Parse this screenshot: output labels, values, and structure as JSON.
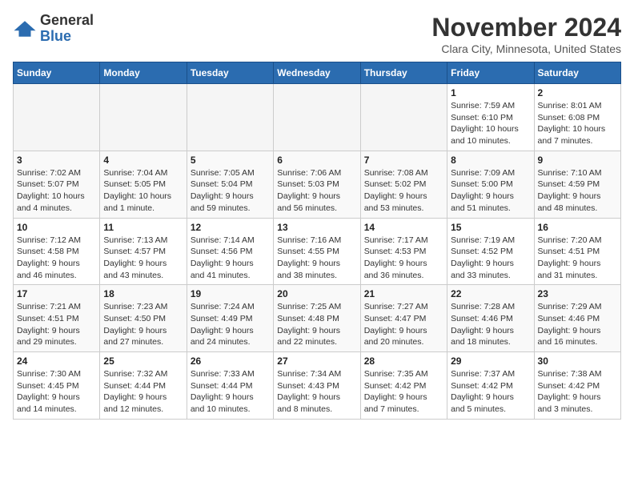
{
  "logo": {
    "general": "General",
    "blue": "Blue"
  },
  "header": {
    "month": "November 2024",
    "location": "Clara City, Minnesota, United States"
  },
  "weekdays": [
    "Sunday",
    "Monday",
    "Tuesday",
    "Wednesday",
    "Thursday",
    "Friday",
    "Saturday"
  ],
  "weeks": [
    [
      {
        "day": "",
        "info": ""
      },
      {
        "day": "",
        "info": ""
      },
      {
        "day": "",
        "info": ""
      },
      {
        "day": "",
        "info": ""
      },
      {
        "day": "",
        "info": ""
      },
      {
        "day": "1",
        "info": "Sunrise: 7:59 AM\nSunset: 6:10 PM\nDaylight: 10 hours\nand 10 minutes."
      },
      {
        "day": "2",
        "info": "Sunrise: 8:01 AM\nSunset: 6:08 PM\nDaylight: 10 hours\nand 7 minutes."
      }
    ],
    [
      {
        "day": "3",
        "info": "Sunrise: 7:02 AM\nSunset: 5:07 PM\nDaylight: 10 hours\nand 4 minutes."
      },
      {
        "day": "4",
        "info": "Sunrise: 7:04 AM\nSunset: 5:05 PM\nDaylight: 10 hours\nand 1 minute."
      },
      {
        "day": "5",
        "info": "Sunrise: 7:05 AM\nSunset: 5:04 PM\nDaylight: 9 hours\nand 59 minutes."
      },
      {
        "day": "6",
        "info": "Sunrise: 7:06 AM\nSunset: 5:03 PM\nDaylight: 9 hours\nand 56 minutes."
      },
      {
        "day": "7",
        "info": "Sunrise: 7:08 AM\nSunset: 5:02 PM\nDaylight: 9 hours\nand 53 minutes."
      },
      {
        "day": "8",
        "info": "Sunrise: 7:09 AM\nSunset: 5:00 PM\nDaylight: 9 hours\nand 51 minutes."
      },
      {
        "day": "9",
        "info": "Sunrise: 7:10 AM\nSunset: 4:59 PM\nDaylight: 9 hours\nand 48 minutes."
      }
    ],
    [
      {
        "day": "10",
        "info": "Sunrise: 7:12 AM\nSunset: 4:58 PM\nDaylight: 9 hours\nand 46 minutes."
      },
      {
        "day": "11",
        "info": "Sunrise: 7:13 AM\nSunset: 4:57 PM\nDaylight: 9 hours\nand 43 minutes."
      },
      {
        "day": "12",
        "info": "Sunrise: 7:14 AM\nSunset: 4:56 PM\nDaylight: 9 hours\nand 41 minutes."
      },
      {
        "day": "13",
        "info": "Sunrise: 7:16 AM\nSunset: 4:55 PM\nDaylight: 9 hours\nand 38 minutes."
      },
      {
        "day": "14",
        "info": "Sunrise: 7:17 AM\nSunset: 4:53 PM\nDaylight: 9 hours\nand 36 minutes."
      },
      {
        "day": "15",
        "info": "Sunrise: 7:19 AM\nSunset: 4:52 PM\nDaylight: 9 hours\nand 33 minutes."
      },
      {
        "day": "16",
        "info": "Sunrise: 7:20 AM\nSunset: 4:51 PM\nDaylight: 9 hours\nand 31 minutes."
      }
    ],
    [
      {
        "day": "17",
        "info": "Sunrise: 7:21 AM\nSunset: 4:51 PM\nDaylight: 9 hours\nand 29 minutes."
      },
      {
        "day": "18",
        "info": "Sunrise: 7:23 AM\nSunset: 4:50 PM\nDaylight: 9 hours\nand 27 minutes."
      },
      {
        "day": "19",
        "info": "Sunrise: 7:24 AM\nSunset: 4:49 PM\nDaylight: 9 hours\nand 24 minutes."
      },
      {
        "day": "20",
        "info": "Sunrise: 7:25 AM\nSunset: 4:48 PM\nDaylight: 9 hours\nand 22 minutes."
      },
      {
        "day": "21",
        "info": "Sunrise: 7:27 AM\nSunset: 4:47 PM\nDaylight: 9 hours\nand 20 minutes."
      },
      {
        "day": "22",
        "info": "Sunrise: 7:28 AM\nSunset: 4:46 PM\nDaylight: 9 hours\nand 18 minutes."
      },
      {
        "day": "23",
        "info": "Sunrise: 7:29 AM\nSunset: 4:46 PM\nDaylight: 9 hours\nand 16 minutes."
      }
    ],
    [
      {
        "day": "24",
        "info": "Sunrise: 7:30 AM\nSunset: 4:45 PM\nDaylight: 9 hours\nand 14 minutes."
      },
      {
        "day": "25",
        "info": "Sunrise: 7:32 AM\nSunset: 4:44 PM\nDaylight: 9 hours\nand 12 minutes."
      },
      {
        "day": "26",
        "info": "Sunrise: 7:33 AM\nSunset: 4:44 PM\nDaylight: 9 hours\nand 10 minutes."
      },
      {
        "day": "27",
        "info": "Sunrise: 7:34 AM\nSunset: 4:43 PM\nDaylight: 9 hours\nand 8 minutes."
      },
      {
        "day": "28",
        "info": "Sunrise: 7:35 AM\nSunset: 4:42 PM\nDaylight: 9 hours\nand 7 minutes."
      },
      {
        "day": "29",
        "info": "Sunrise: 7:37 AM\nSunset: 4:42 PM\nDaylight: 9 hours\nand 5 minutes."
      },
      {
        "day": "30",
        "info": "Sunrise: 7:38 AM\nSunset: 4:42 PM\nDaylight: 9 hours\nand 3 minutes."
      }
    ]
  ]
}
